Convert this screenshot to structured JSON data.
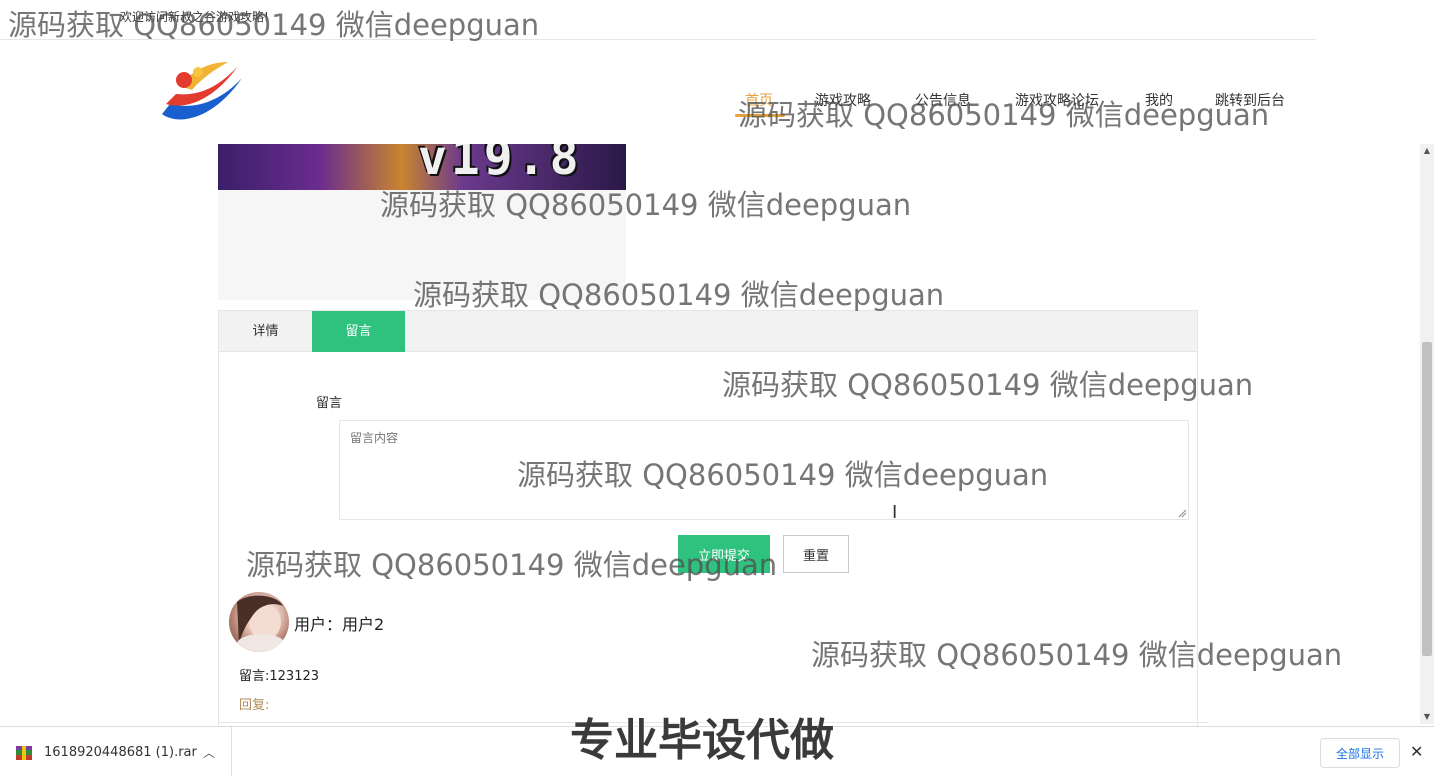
{
  "header": {
    "welcome": "欢迎访问新叔之谷游戏攻略!",
    "nav": [
      {
        "label": "首页",
        "active": true
      },
      {
        "label": "游戏攻略"
      },
      {
        "label": "公告信息"
      },
      {
        "label": "游戏攻略论坛"
      },
      {
        "label": "我的"
      },
      {
        "label": "跳转到后台"
      }
    ]
  },
  "banner": {
    "text": "v19.8"
  },
  "tabs": [
    {
      "label": "详情"
    },
    {
      "label": "留言",
      "active": true
    }
  ],
  "form": {
    "label": "留言",
    "placeholder": "留言内容",
    "value": "",
    "submit_label": "立即提交",
    "reset_label": "重置"
  },
  "comment": {
    "user_line": "用户：用户2",
    "content": "留言:123123",
    "reply": "回复:"
  },
  "download": {
    "file_name": "1618920448681 (1).rar",
    "show_all": "全部显示"
  },
  "watermarks": {
    "text": "源码获取 QQ86050149 微信deepguan",
    "big": "专业毕设代做"
  },
  "colors": {
    "accent_green": "#2ec27e",
    "nav_active": "#e6a23c",
    "reply": "#b08a5a"
  }
}
